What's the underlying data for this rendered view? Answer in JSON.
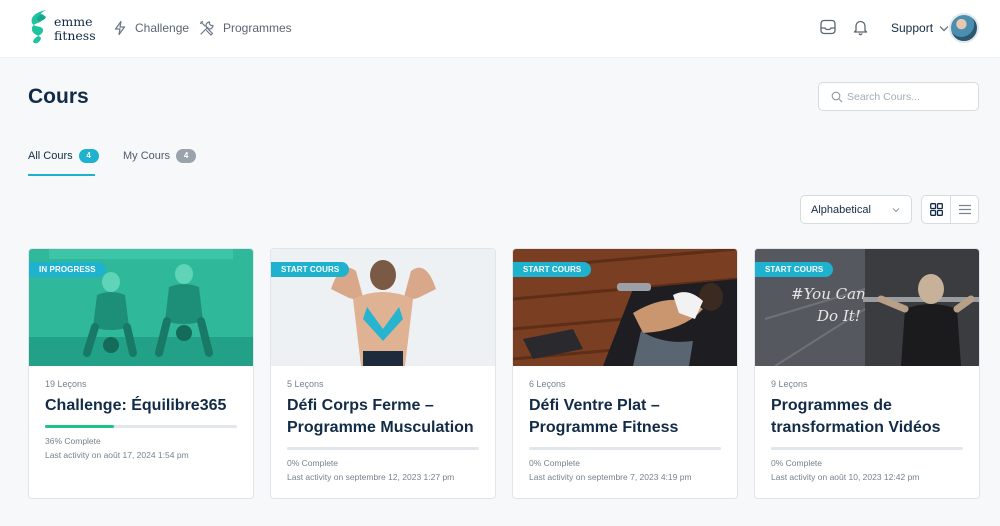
{
  "brand": {
    "line1": "emme",
    "line2": "fitness",
    "color": "#1ec3a0"
  },
  "nav": [
    {
      "label": "Challenge",
      "icon": "lightning-icon"
    },
    {
      "label": "Programmes",
      "icon": "tools-icon"
    }
  ],
  "header": {
    "support_label": "Support"
  },
  "page": {
    "title": "Cours"
  },
  "search": {
    "placeholder": "Search Cours..."
  },
  "tabs": [
    {
      "label": "All Cours",
      "count": "4",
      "active": true
    },
    {
      "label": "My Cours",
      "count": "4",
      "active": false
    }
  ],
  "sort": {
    "selected": "Alphabetical"
  },
  "colors": {
    "accent": "#1fb2cf",
    "progress": "#1ec387",
    "text": "#122b46"
  },
  "courses": [
    {
      "status": "IN PROGRESS",
      "lessons": "19 Leçons",
      "title": "Challenge: Équilibre365",
      "progress": 36,
      "complete": "36% Complete",
      "activity": "Last activity on août 17, 2024 1:54 pm"
    },
    {
      "status": "START COURS",
      "lessons": "5 Leçons",
      "title": "Défi Corps Ferme – Programme Musculation",
      "progress": 0,
      "complete": "0% Complete",
      "activity": "Last activity on septembre 12, 2023 1:27 pm"
    },
    {
      "status": "START COURS",
      "lessons": "6 Leçons",
      "title": "Défi Ventre Plat – Programme Fitness",
      "progress": 0,
      "complete": "0% Complete",
      "activity": "Last activity on septembre 7, 2023 4:19 pm"
    },
    {
      "status": "START COURS",
      "lessons": "9 Leçons",
      "title": "Programmes de transformation Vidéos",
      "progress": 0,
      "complete": "0% Complete",
      "activity": "Last activity on août 10, 2023 12:42 pm"
    }
  ],
  "thumb_art": {
    "overlay_text_1": "#You Can",
    "overlay_text_2": "Do It!"
  }
}
